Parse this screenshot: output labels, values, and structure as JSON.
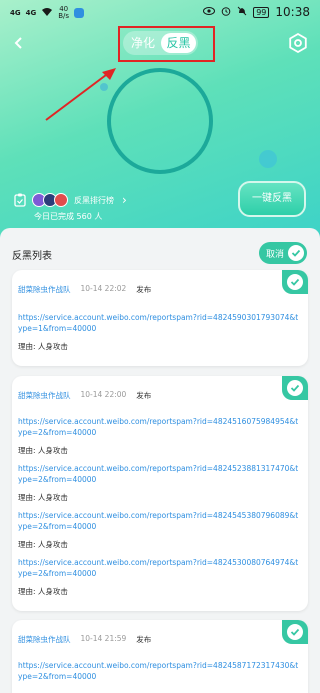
{
  "status_bar": {
    "signal_left": "4G",
    "signal_right": "4G",
    "speed_value": "40",
    "speed_unit": "B/s",
    "battery": "99",
    "time": "10:38"
  },
  "header": {
    "toggle": {
      "option_1": "净化",
      "option_2": "反黑",
      "selected": "反黑"
    }
  },
  "stats": {
    "rank_label": "反黑排行榜",
    "today_text": "今日已完成 560 人"
  },
  "one_click_button": "一键反黑",
  "list": {
    "title": "反黑列表",
    "cancel_label": "取消",
    "reason_prefix": "理由:",
    "cards": [
      {
        "author": "甜菜除虫作战队",
        "time": "10-14 22:02",
        "action": "发布",
        "reports": [
          {
            "url": "https://service.account.weibo.com/reportspam?rid=4824590301793074&type=1&from=40000",
            "reason": "人身攻击"
          }
        ]
      },
      {
        "author": "甜菜除虫作战队",
        "time": "10-14 22:00",
        "action": "发布",
        "reports": [
          {
            "url": "https://service.account.weibo.com/reportspam?rid=4824516075984954&type=2&from=40000",
            "reason": "人身攻击"
          },
          {
            "url": "https://service.account.weibo.com/reportspam?rid=4824523881317470&type=2&from=40000",
            "reason": "人身攻击"
          },
          {
            "url": "https://service.account.weibo.com/reportspam?rid=4824545380796089&type=2&from=40000",
            "reason": "人身攻击"
          },
          {
            "url": "https://service.account.weibo.com/reportspam?rid=4824530080764974&type=2&from=40000",
            "reason": "人身攻击"
          }
        ]
      },
      {
        "author": "甜菜除虫作战队",
        "time": "10-14 21:59",
        "action": "发布",
        "reports": [
          {
            "url": "https://service.account.weibo.com/reportspam?rid=4824587172317430&type=2&from=40000",
            "reason": ""
          }
        ]
      }
    ]
  },
  "colors": {
    "accent": "#36c7a3",
    "link": "#2f8fe0",
    "highlight_box": "#e12424"
  }
}
